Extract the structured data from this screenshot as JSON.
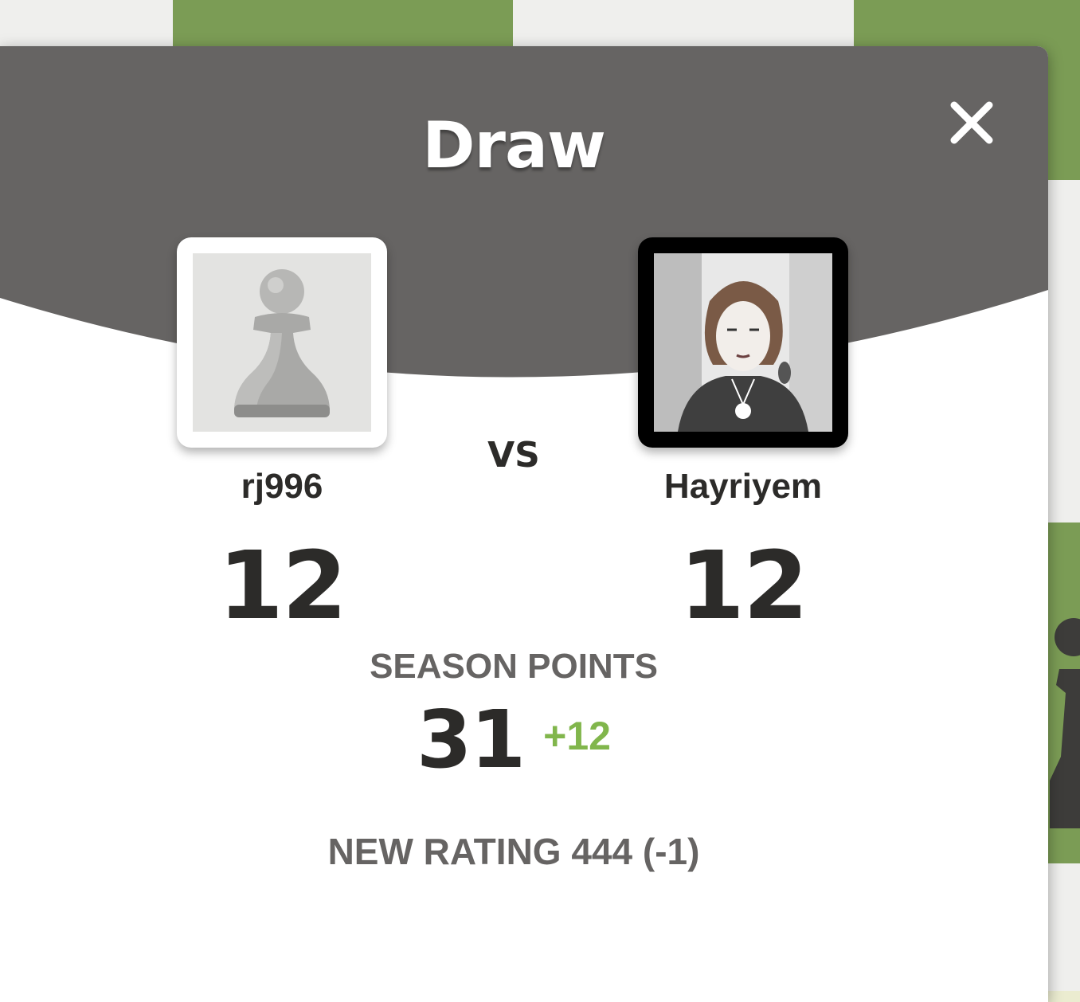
{
  "result": {
    "title": "Draw"
  },
  "players": {
    "left": {
      "username": "rj996",
      "score": "12",
      "avatar": "pawn-icon"
    },
    "vs_label": "VS",
    "right": {
      "username": "Hayriyem",
      "score": "12",
      "avatar": "profile-photo"
    }
  },
  "season": {
    "label": "SEASON POINTS",
    "value": "31",
    "delta": "+12"
  },
  "rating": {
    "text": "NEW RATING 444 (-1)"
  },
  "colors": {
    "header": "#666463",
    "board_dark": "#7b9c55",
    "board_light": "#efefed",
    "positive": "#81b64c",
    "text_dark": "#2c2b29"
  }
}
